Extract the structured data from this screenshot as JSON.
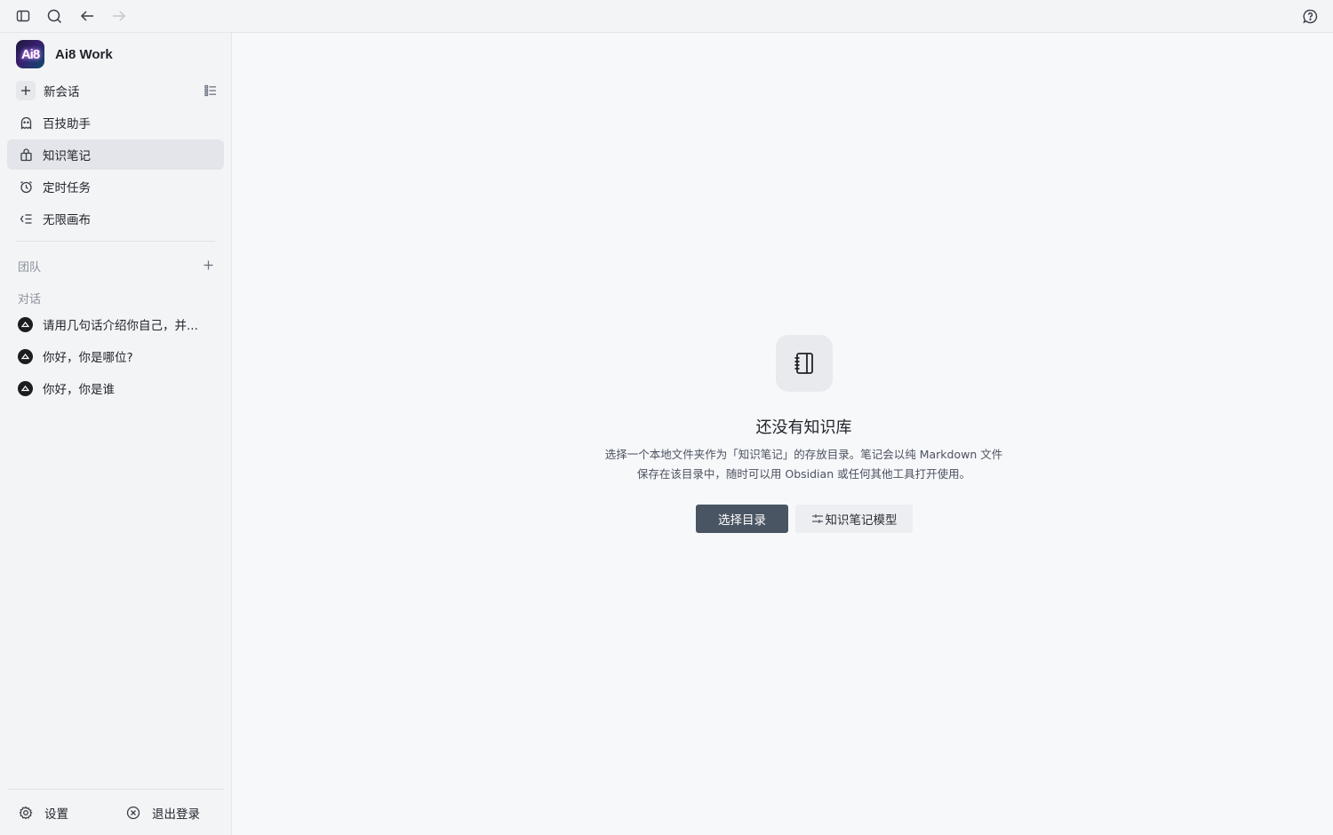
{
  "app": {
    "name": "Ai8 Work",
    "logo_text": "Ai8"
  },
  "topbar": {
    "icons": [
      "sidebar-toggle-icon",
      "search-icon",
      "back-arrow-icon",
      "forward-arrow-icon",
      "help-icon"
    ]
  },
  "sidebar": {
    "new_chat": "新会话",
    "items": [
      {
        "label": "百技助手",
        "icon": "ghost-icon"
      },
      {
        "label": "知识笔记",
        "icon": "knowledge-icon",
        "active": true
      },
      {
        "label": "定时任务",
        "icon": "alarm-clock-icon"
      },
      {
        "label": "无限画布",
        "icon": "canvas-list-icon"
      }
    ],
    "team_label": "团队",
    "conversations_label": "对话",
    "conversations": [
      {
        "title": "请用几句话介绍你自己，并..."
      },
      {
        "title": "你好，你是哪位?"
      },
      {
        "title": "你好，你是谁"
      }
    ],
    "settings": "设置",
    "logout": "退出登录"
  },
  "main": {
    "empty_title": "还没有知识库",
    "empty_desc_line1": "选择一个本地文件夹作为「知识笔记」的存放目录。笔记会以纯 Markdown 文件",
    "empty_desc_line2": "保存在该目录中，随时可以用 Obsidian 或任何其他工具打开使用。",
    "primary_button": "选择目录",
    "secondary_button": "知识笔记模型"
  },
  "colors": {
    "sidebar_bg": "#f3f4f6",
    "active_item_bg": "#e3e5ea",
    "primary_button_bg": "#4a5563",
    "main_bg": "#f7f8fa"
  }
}
